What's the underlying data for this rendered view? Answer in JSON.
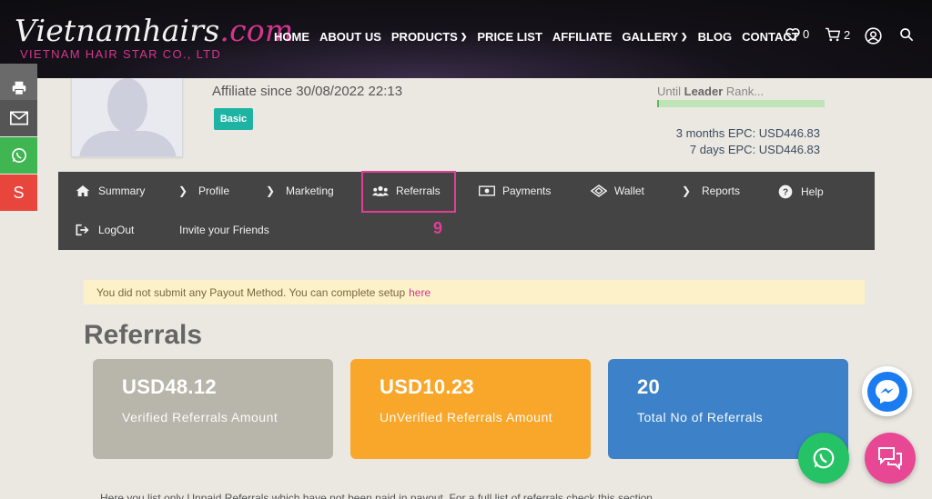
{
  "header": {
    "logo_main": "Vietnamhairs",
    "logo_com": ".com",
    "logo_sub": "VIETNAM HAIR STAR CO., LTD",
    "nav": [
      {
        "label": "HOME"
      },
      {
        "label": "ABOUT US"
      },
      {
        "label": "PRODUCTS",
        "dropdown": true
      },
      {
        "label": "PRICE LIST"
      },
      {
        "label": "AFFILIATE"
      },
      {
        "label": "GALLERY",
        "dropdown": true
      },
      {
        "label": "BLOG"
      },
      {
        "label": "CONTACT"
      }
    ],
    "wishlist_count": "0",
    "cart_count": "2"
  },
  "profile": {
    "affiliate_since": "Affiliate since 30/08/2022 22:13",
    "badge": "Basic",
    "until_prefix": "Until",
    "until_rank": "Leader",
    "until_suffix": "Rank...",
    "rank_progress_fraction": 0.01,
    "epc_3_months": "3 months EPC: USD446.83",
    "epc_7_days": "7 days EPC: USD446.83"
  },
  "menu": {
    "items": [
      {
        "label": "Summary",
        "icon": "home-icon"
      },
      {
        "label": "Profile",
        "icon": "chevron-right-icon"
      },
      {
        "label": "Marketing",
        "icon": "chevron-right-icon"
      },
      {
        "label": "Referrals",
        "icon": "users-icon",
        "active": true
      },
      {
        "label": "Payments",
        "icon": "money-icon"
      },
      {
        "label": "Wallet",
        "icon": "diamond-icon"
      },
      {
        "label": "Reports",
        "icon": "chevron-right-icon"
      },
      {
        "label": "Help",
        "icon": "help-icon"
      },
      {
        "label": "LogOut",
        "icon": "logout-icon"
      },
      {
        "label": "Invite your Friends",
        "icon": ""
      }
    ],
    "step_number": "9"
  },
  "notice": {
    "text": "You did not submit any Payout Method. You can complete setup",
    "link": "here"
  },
  "section_title": "Referrals",
  "cards": [
    {
      "amount": "USD48.12",
      "label": "Verified Referrals Amount",
      "color": "#b8b5aa"
    },
    {
      "amount": "USD10.23",
      "label": "UnVerified Referrals Amount",
      "color": "#f9a72b"
    },
    {
      "amount": "20",
      "label": "Total No of Referrals",
      "color": "#3d82c8"
    }
  ],
  "bottom_text": "Here you list only Unpaid Referrals which have not been paid in payout. For a full list of referrals check this section",
  "colors": {
    "accent": "#d6358f",
    "menu_bg": "#444444",
    "whatsapp": "#26c266",
    "messenger": "#1a7cf0",
    "chat": "#e84793",
    "share_print": "#6a6a6a",
    "share_email": "#555555",
    "share_whatsapp": "#3fb652",
    "share_s": "#e8453c"
  }
}
